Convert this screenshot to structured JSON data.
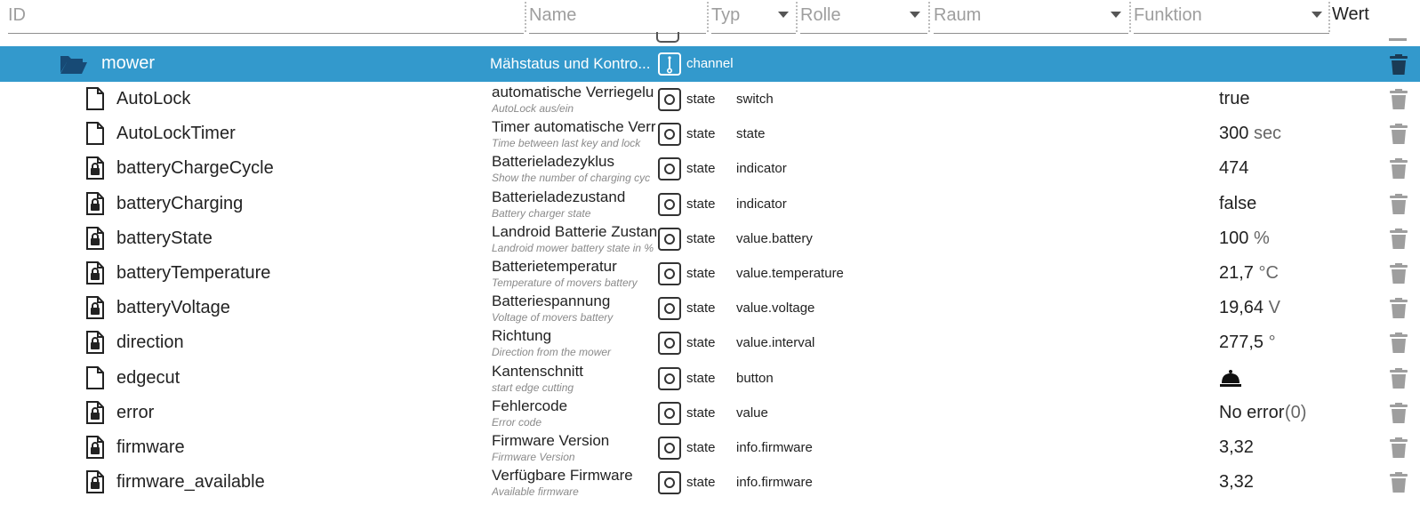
{
  "header": {
    "filters": [
      {
        "key": "id",
        "label": "ID",
        "dropdown": false
      },
      {
        "key": "name",
        "label": "Name",
        "dropdown": false
      },
      {
        "key": "type",
        "label": "Typ",
        "dropdown": true
      },
      {
        "key": "role",
        "label": "Rolle",
        "dropdown": true
      },
      {
        "key": "room",
        "label": "Raum",
        "dropdown": true
      },
      {
        "key": "function",
        "label": "Funktion",
        "dropdown": true
      }
    ],
    "value_column": "Wert"
  },
  "channel": {
    "id": "mower",
    "name": "Mähstatus und Kontro...",
    "type": "channel",
    "icon": "folder-open-icon"
  },
  "rows": [
    {
      "id": "AutoLock",
      "locked": false,
      "name": "automatische Verriegelu",
      "desc": "AutoLock aus/ein",
      "type": "state",
      "role": "switch",
      "value": "true",
      "unit": ""
    },
    {
      "id": "AutoLockTimer",
      "locked": false,
      "name": "Timer automatische Verr",
      "desc": "Time between last key and lock",
      "type": "state",
      "role": "state",
      "value": "300",
      "unit": "sec"
    },
    {
      "id": "batteryChargeCycle",
      "locked": true,
      "name": "Batterieladezyklus",
      "desc": "Show the number of charging cyc",
      "type": "state",
      "role": "indicator",
      "value": "474",
      "unit": ""
    },
    {
      "id": "batteryCharging",
      "locked": true,
      "name": "Batterieladezustand",
      "desc": "Battery charger state",
      "type": "state",
      "role": "indicator",
      "value": "false",
      "unit": ""
    },
    {
      "id": "batteryState",
      "locked": true,
      "name": "Landroid Batterie Zustan",
      "desc": "Landroid mower battery state in %",
      "type": "state",
      "role": "value.battery",
      "value": "100",
      "unit": "%"
    },
    {
      "id": "batteryTemperature",
      "locked": true,
      "name": "Batterietemperatur",
      "desc": "Temperature of movers battery",
      "type": "state",
      "role": "value.temperature",
      "value": "21,7",
      "unit": "°C"
    },
    {
      "id": "batteryVoltage",
      "locked": true,
      "name": "Batteriespannung",
      "desc": "Voltage of movers battery",
      "type": "state",
      "role": "value.voltage",
      "value": "19,64",
      "unit": "V"
    },
    {
      "id": "direction",
      "locked": true,
      "name": "Richtung",
      "desc": "Direction from the mower",
      "type": "state",
      "role": "value.interval",
      "value": "277,5",
      "unit": "°"
    },
    {
      "id": "edgecut",
      "locked": false,
      "name": "Kantenschnitt",
      "desc": "start edge cutting",
      "type": "state",
      "role": "button",
      "value": "",
      "unit": "",
      "value_icon": "bell-icon"
    },
    {
      "id": "error",
      "locked": true,
      "name": "Fehlercode",
      "desc": "Error code",
      "type": "state",
      "role": "value",
      "value": "No error",
      "unit": "(0)"
    },
    {
      "id": "firmware",
      "locked": true,
      "name": "Firmware Version",
      "desc": "Firmware Version",
      "type": "state",
      "role": "info.firmware",
      "value": "3,32",
      "unit": ""
    },
    {
      "id": "firmware_available",
      "locked": true,
      "name": "Verfügbare Firmware",
      "desc": "Available firmware",
      "type": "state",
      "role": "info.firmware",
      "value": "3,32",
      "unit": ""
    }
  ]
}
